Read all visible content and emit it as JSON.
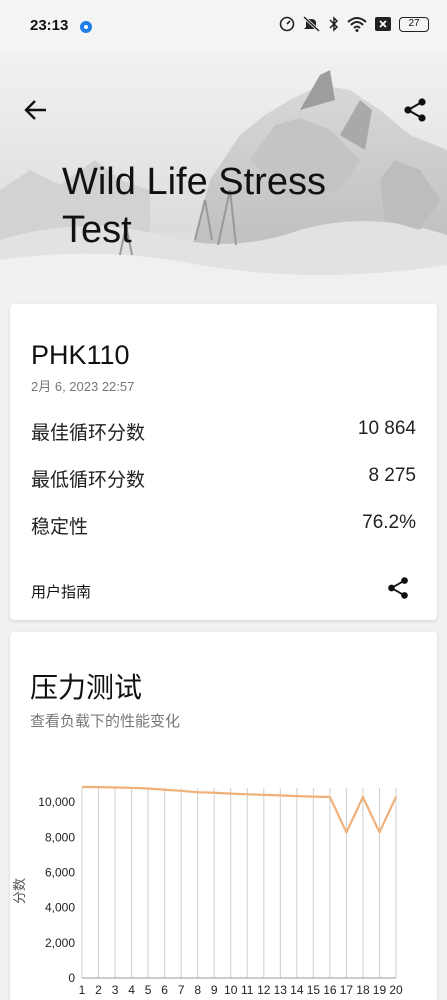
{
  "status_bar": {
    "time": "23:13",
    "battery": "27",
    "icons": [
      "location-dot-icon",
      "speedometer-icon",
      "mute-icon",
      "bluetooth-icon",
      "wifi-icon",
      "x-box-icon",
      "battery-icon"
    ]
  },
  "header": {
    "title": "Wild Life Stress Test",
    "back_icon": "arrow-left-icon",
    "share_icon": "share-icon"
  },
  "result": {
    "device": "PHK110",
    "date": "2月 6, 2023 22:57",
    "best_label": "最佳循环分数",
    "best_value": "10 864",
    "low_label": "最低循环分数",
    "low_value": "8 275",
    "stability_label": "稳定性",
    "stability_value": "76.2%",
    "guide_label": "用户指南",
    "guide_share_icon": "share-icon"
  },
  "stress": {
    "title": "压力测试",
    "subtitle": "查看负载下的性能变化"
  },
  "colors": {
    "line": "#f0b07a",
    "grid": "#cfcfcf",
    "text": "#111111",
    "muted": "#777777"
  },
  "chart_data": {
    "type": "line",
    "ylabel": "分数",
    "xlabel": "",
    "ylim": [
      0,
      10000
    ],
    "yticks": [
      0,
      2000,
      4000,
      6000,
      8000,
      10000
    ],
    "ytick_labels": [
      "0",
      "2,000",
      "4,000",
      "6,000",
      "8,000",
      "10,000"
    ],
    "x": [
      1,
      2,
      3,
      4,
      5,
      6,
      7,
      8,
      9,
      10,
      11,
      12,
      13,
      14,
      15,
      16,
      17,
      18,
      19,
      20
    ],
    "series": [
      {
        "values": [
          10864,
          10850,
          10830,
          10810,
          10770,
          10700,
          10640,
          10560,
          10530,
          10480,
          10440,
          10410,
          10380,
          10340,
          10310,
          10290,
          8275,
          10290,
          8280,
          10300
        ]
      }
    ]
  }
}
